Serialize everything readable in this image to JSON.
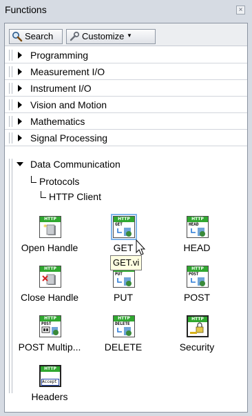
{
  "window": {
    "title": "Functions",
    "close_glyph": "×"
  },
  "toolbar": {
    "search_label": "Search",
    "customize_label": "Customize"
  },
  "categories": [
    {
      "label": "Programming",
      "expanded": false
    },
    {
      "label": "Measurement I/O",
      "expanded": false
    },
    {
      "label": "Instrument I/O",
      "expanded": false
    },
    {
      "label": "Vision and Motion",
      "expanded": false
    },
    {
      "label": "Mathematics",
      "expanded": false
    },
    {
      "label": "Signal Processing",
      "expanded": false
    },
    {
      "label": "Data Communication",
      "expanded": true
    }
  ],
  "tree": {
    "level1": "Protocols",
    "level2": "HTTP Client"
  },
  "palette": [
    {
      "label": "Open Handle",
      "band": "HTTP",
      "sub": "",
      "icon": "open-handle-icon"
    },
    {
      "label": "GET",
      "band": "HTTP",
      "sub": "GET",
      "icon": "get-icon"
    },
    {
      "label": "HEAD",
      "band": "HTTP",
      "sub": "HEAD",
      "icon": "head-icon"
    },
    {
      "label": "Close Handle",
      "band": "HTTP",
      "sub": "",
      "icon": "close-handle-icon"
    },
    {
      "label": "PUT",
      "band": "HTTP",
      "sub": "PUT",
      "icon": "put-icon"
    },
    {
      "label": "POST",
      "band": "HTTP",
      "sub": "POST",
      "icon": "post-icon"
    },
    {
      "label": "POST Multip...",
      "band": "HTTP",
      "sub": "POST",
      "icon": "post-multipart-icon"
    },
    {
      "label": "DELETE",
      "band": "HTTP",
      "sub": "DELETE",
      "icon": "delete-icon"
    },
    {
      "label": "Security",
      "band": "HTTP",
      "sub": "",
      "icon": "security-icon"
    },
    {
      "label": "Headers",
      "band": "HTTP",
      "sub": "Accept",
      "icon": "headers-icon"
    }
  ],
  "tooltip": "GET.vi",
  "colors": {
    "http_band": "#30a830",
    "selection": "#7eb4ea",
    "tooltip_bg": "#ffffe1"
  }
}
